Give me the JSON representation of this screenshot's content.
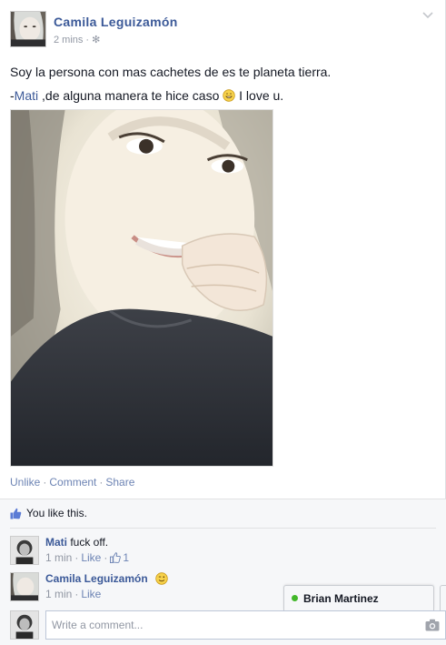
{
  "post": {
    "author": "Camila Leguizamón",
    "time": "2 mins",
    "meta_sep": "·",
    "privacy_icon": "gear-icon",
    "menu_icon": "chevron-down-icon",
    "text_line1": "Soy la persona con mas cachetes de es te planeta tierra.",
    "text_line2_prefix": "-",
    "text_line2_tag": "Mati",
    "text_line2_middle": " ,de alguna manera te hice caso ",
    "text_line2_emoji": "grin-emoji",
    "text_line2_suffix": " I love u.",
    "photo_icon": "selfie-photo"
  },
  "actions": {
    "unlike": "Unlike",
    "comment": "Comment",
    "share": "Share",
    "sep": "·"
  },
  "likes": {
    "icon": "thumbs-up-icon",
    "text": "You like this."
  },
  "comments": [
    {
      "author": "Mati",
      "text": "fuck off.",
      "time": "1 min",
      "like_label": "Like",
      "like_count": "1",
      "sep": "·"
    },
    {
      "author": "Camila Leguizamón",
      "text": "",
      "emoji": "wink-emoji",
      "time": "1 min",
      "like_label": "Like",
      "sep": "·"
    }
  ],
  "compose": {
    "placeholder": "Write a comment...",
    "camera_icon": "camera-icon"
  },
  "chat": {
    "contact": "Brian Martinez",
    "status": "online"
  },
  "colors": {
    "link": "#3b5998",
    "muted": "#9197a3",
    "action": "#6d84b4",
    "feedback_bg": "#f6f7f9",
    "online": "#42b72a"
  }
}
